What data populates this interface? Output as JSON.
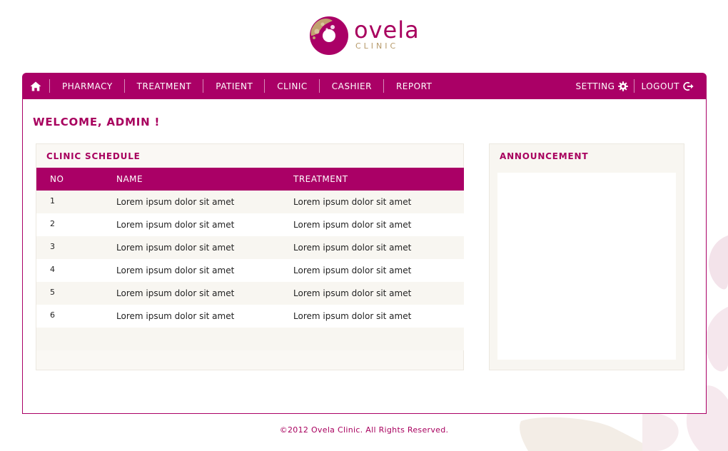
{
  "brand": {
    "name": "ovela",
    "subtitle": "CLINIC",
    "primary_color": "#aa0066",
    "accent_color": "#b79a6a"
  },
  "nav": {
    "home_icon": "home-icon",
    "items": [
      {
        "label": "PHARMACY"
      },
      {
        "label": "TREATMENT"
      },
      {
        "label": "PATIENT"
      },
      {
        "label": "CLINIC"
      },
      {
        "label": "CASHIER"
      },
      {
        "label": "REPORT"
      }
    ],
    "setting_label": "SETTING",
    "setting_icon": "gear-icon",
    "logout_label": "LOGOUT",
    "logout_icon": "logout-icon"
  },
  "welcome": "WELCOME, ADMIN !",
  "schedule": {
    "title": "CLINIC SCHEDULE",
    "headers": {
      "no": "NO",
      "name": "NAME",
      "treatment": "TREATMENT"
    },
    "rows": [
      {
        "no": "1",
        "name": "Lorem ipsum dolor sit amet",
        "treatment": "Lorem ipsum dolor sit amet"
      },
      {
        "no": "2",
        "name": "Lorem ipsum dolor sit amet",
        "treatment": "Lorem ipsum dolor sit amet"
      },
      {
        "no": "3",
        "name": "Lorem ipsum dolor sit amet",
        "treatment": "Lorem ipsum dolor sit amet"
      },
      {
        "no": "4",
        "name": "Lorem ipsum dolor sit amet",
        "treatment": "Lorem ipsum dolor sit amet"
      },
      {
        "no": "5",
        "name": "Lorem ipsum dolor sit amet",
        "treatment": "Lorem ipsum dolor sit amet"
      },
      {
        "no": "6",
        "name": "Lorem ipsum dolor sit amet",
        "treatment": "Lorem ipsum dolor sit amet"
      },
      {
        "no": "",
        "name": "",
        "treatment": ""
      }
    ]
  },
  "announcement": {
    "title": "ANNOUNCEMENT"
  },
  "footer": "©2012 Ovela Clinic. All Rights Reserved."
}
